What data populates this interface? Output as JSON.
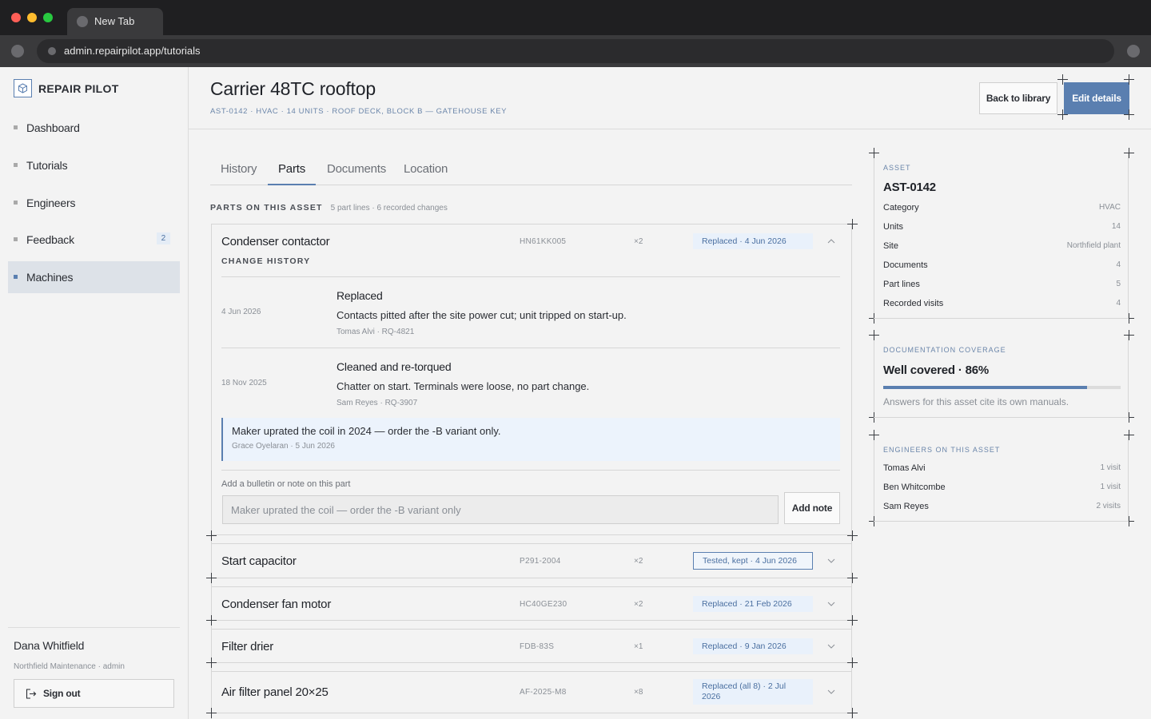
{
  "browser": {
    "tab_title": "New Tab",
    "url": "admin.repairpilot.app/tutorials"
  },
  "brand": {
    "name": "REPAIR PILOT"
  },
  "sidebar": {
    "items": [
      {
        "label": "Dashboard"
      },
      {
        "label": "Tutorials"
      },
      {
        "label": "Engineers"
      },
      {
        "label": "Feedback",
        "badge": "2"
      },
      {
        "label": "Machines",
        "active": true
      }
    ],
    "user": {
      "name": "Dana Whitfield",
      "org": "Northfield Maintenance · admin"
    },
    "signout_label": "Sign out"
  },
  "header": {
    "title": "Carrier 48TC rooftop",
    "subtitle": "AST-0142 · HVAC · 14 UNITS · ROOF DECK, BLOCK B — GATEHOUSE KEY",
    "back_label": "Back to library",
    "edit_label": "Edit details"
  },
  "tabs": [
    "History",
    "Parts",
    "Documents",
    "Location"
  ],
  "parts": {
    "section_title": "PARTS ON THIS ASSET",
    "section_meta": "5 part lines · 6 recorded changes",
    "rows": [
      {
        "name": "Condenser contactor",
        "code": "HN61KK005",
        "qty": "×2",
        "status": "Replaced · 4 Jun 2026"
      },
      {
        "name": "Start capacitor",
        "code": "P291-2004",
        "qty": "×2",
        "status": "Tested, kept · 4 Jun 2026"
      },
      {
        "name": "Condenser fan motor",
        "code": "HC40GE230",
        "qty": "×2",
        "status": "Replaced · 21 Feb 2026"
      },
      {
        "name": "Filter drier",
        "code": "FDB-83S",
        "qty": "×1",
        "status": "Replaced · 9 Jan 2026"
      },
      {
        "name": "Air filter panel 20×25",
        "code": "AF-2025-M8",
        "qty": "×8",
        "status": "Replaced (all 8) · 2 Jul 2026"
      }
    ],
    "change_history": {
      "title": "CHANGE HISTORY",
      "entries": [
        {
          "date": "4 Jun 2026",
          "action": "Replaced",
          "desc": "Contacts pitted after the site power cut; unit tripped on start-up.",
          "meta": "Tomas Alvi  ·  RQ-4821"
        },
        {
          "date": "18 Nov 2025",
          "action": "Cleaned and re-torqued",
          "desc": "Chatter on start. Terminals were loose, no part change.",
          "meta": "Sam Reyes  ·  RQ-3907"
        }
      ],
      "note": {
        "text": "Maker uprated the coil in 2024 — order the -B variant only.",
        "meta": "Grace Oyelaran · 5 Jun 2026"
      },
      "add_label": "Add a bulletin or note on this part",
      "input_value": "Maker uprated the coil — order the -B variant only",
      "add_button": "Add note"
    }
  },
  "asset_panel": {
    "label": "ASSET",
    "id": "AST-0142",
    "rows": [
      {
        "k": "Category",
        "v": "HVAC"
      },
      {
        "k": "Units",
        "v": "14"
      },
      {
        "k": "Site",
        "v": "Northfield plant"
      },
      {
        "k": "Documents",
        "v": "4"
      },
      {
        "k": "Part lines",
        "v": "5"
      },
      {
        "k": "Recorded visits",
        "v": "4"
      }
    ]
  },
  "coverage_panel": {
    "label": "DOCUMENTATION COVERAGE",
    "heading": "Well covered · 86%",
    "percent": 86,
    "note": "Answers for this asset cite its own manuals."
  },
  "engineers_panel": {
    "label": "ENGINEERS ON THIS ASSET",
    "rows": [
      {
        "k": "Tomas Alvi",
        "v": "1 visit"
      },
      {
        "k": "Ben Whitcombe",
        "v": "1 visit"
      },
      {
        "k": "Sam Reyes",
        "v": "2 visits"
      }
    ]
  },
  "colors": {
    "accent": "#5a7fb0",
    "accent_soft": "#e9f1fb"
  }
}
